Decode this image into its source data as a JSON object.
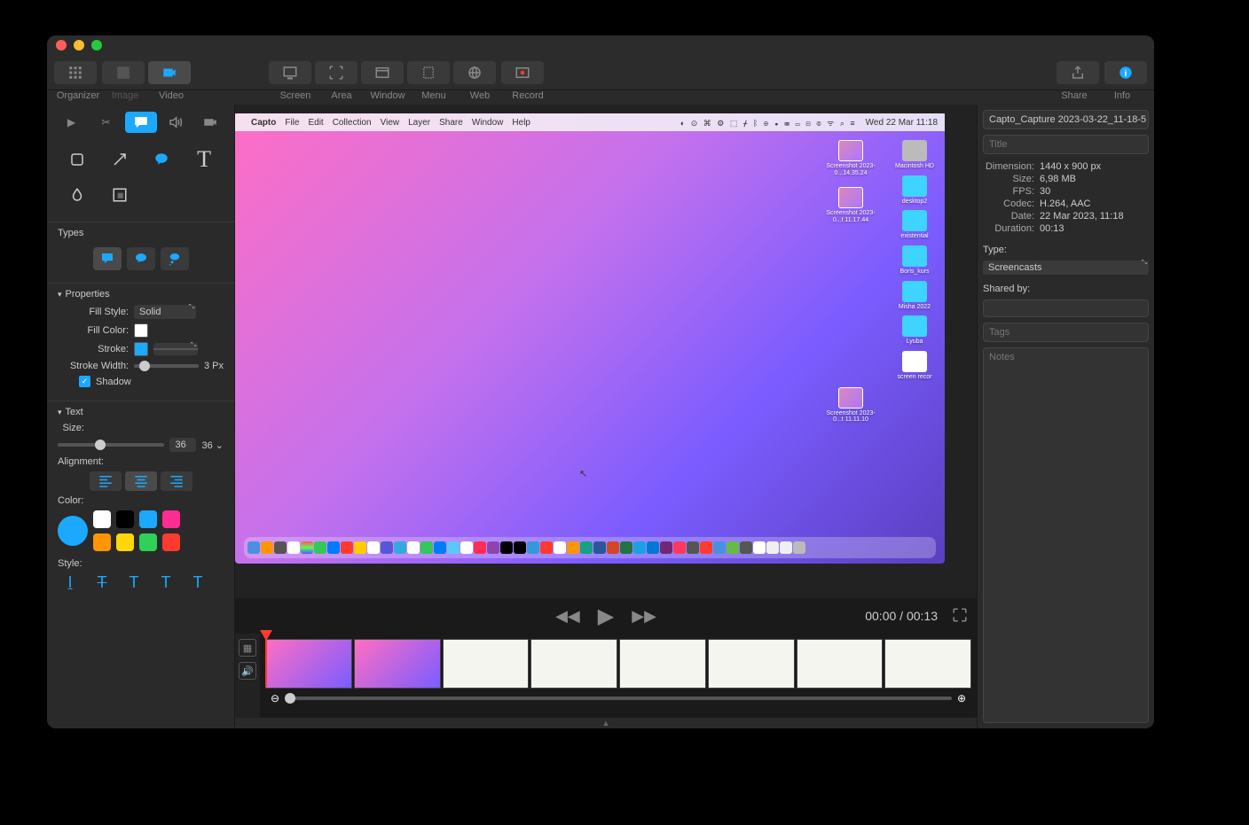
{
  "toolbar": {
    "organizer": "Organizer",
    "image": "Image",
    "video": "Video",
    "screen": "Screen",
    "area": "Area",
    "window": "Window",
    "menu": "Menu",
    "web": "Web",
    "record": "Record",
    "share": "Share",
    "info": "Info"
  },
  "sidebar": {
    "types_label": "Types",
    "properties_label": "Properties",
    "fill_style_label": "Fill Style:",
    "fill_style_value": "Solid",
    "fill_color_label": "Fill Color:",
    "stroke_label": "Stroke:",
    "stroke_width_label": "Stroke Width:",
    "stroke_width_value": "3 Px",
    "shadow_label": "Shadow",
    "text_section": "Text",
    "size_label": "Size:",
    "size_value": "36",
    "size_suffix": "36 ⌄",
    "alignment_label": "Alignment:",
    "color_label": "Color:",
    "style_label": "Style:"
  },
  "preview": {
    "menubar_app": "Capto",
    "menubar_items": [
      "File",
      "Edit",
      "Collection",
      "View",
      "Layer",
      "Share",
      "Window",
      "Help"
    ],
    "menubar_time": "Wed 22 Mar  11:18",
    "desktop_items_col1": [
      {
        "label": "Screenshot 2023-0...14.35.24",
        "type": "img"
      },
      {
        "label": "Screenshot 2023-0...t 11.17.44",
        "type": "img"
      },
      {
        "label": "Screenshot 2023-0...t 11.11.10",
        "type": "img"
      }
    ],
    "desktop_items_col2": [
      {
        "label": "Macintosh HD",
        "type": "hd"
      },
      {
        "label": "desktop2",
        "type": "folder"
      },
      {
        "label": "existential",
        "type": "folder"
      },
      {
        "label": "Boris_kurs",
        "type": "folder"
      },
      {
        "label": "Misha 2022",
        "type": "folder"
      },
      {
        "label": "Lyuba",
        "type": "folder"
      },
      {
        "label": "screen recor",
        "type": "doc"
      }
    ]
  },
  "playbar": {
    "current": "00:00",
    "total": "00:13"
  },
  "info": {
    "filename": "Capto_Capture 2023-03-22_11-18-5",
    "title_placeholder": "Title",
    "dimension_label": "Dimension:",
    "dimension_value": "1440 x 900 px",
    "size_label": "Size:",
    "size_value": "6,98 MB",
    "fps_label": "FPS:",
    "fps_value": "30",
    "codec_label": "Codec:",
    "codec_value": "H.264, AAC",
    "date_label": "Date:",
    "date_value": "22 Mar 2023, 11:18",
    "duration_label": "Duration:",
    "duration_value": "00:13",
    "type_label": "Type:",
    "type_value": "Screencasts",
    "sharedby_label": "Shared by:",
    "tags_placeholder": "Tags",
    "notes_placeholder": "Notes"
  }
}
